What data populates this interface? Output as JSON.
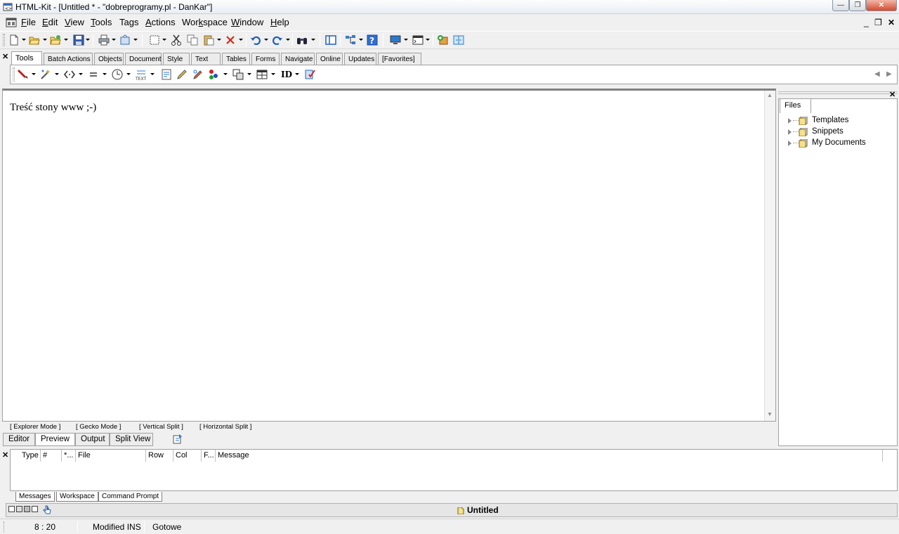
{
  "window": {
    "title": "HTML-Kit - [Untitled * - \"dobreprogramy.pl - DanKar\"]",
    "controls": {
      "minimize": "—",
      "maximize": "❐",
      "close": "✕"
    }
  },
  "menu": {
    "items": [
      {
        "label": "File",
        "accel": "F",
        "rest": "ile"
      },
      {
        "label": "Edit",
        "accel": "E",
        "rest": "dit"
      },
      {
        "label": "View",
        "accel": "V",
        "rest": "iew"
      },
      {
        "label": "Tools",
        "accel": "T",
        "rest": "ools"
      },
      {
        "label": "Tags",
        "pre": "Ta",
        "accel": "g",
        "rest": "s"
      },
      {
        "label": "Actions",
        "accel": "A",
        "rest": "ctions"
      },
      {
        "label": "Workspace",
        "pre": "Wor",
        "accel": "k",
        "rest": "space"
      },
      {
        "label": "Window",
        "accel": "W",
        "rest": "indow"
      },
      {
        "label": "Help",
        "accel": "H",
        "rest": "elp"
      }
    ],
    "mdi": {
      "minimize": "_",
      "restore": "❐",
      "close": "✕"
    }
  },
  "tools_tabs": [
    "Tools",
    "Batch Actions",
    "Objects",
    "Document",
    "Style",
    "Text",
    "Tables",
    "Forms",
    "Navigate",
    "Online",
    "Updates",
    "[Favorites]"
  ],
  "tools_row": {
    "id_label": "ID"
  },
  "editor": {
    "content": "Treść stony www ;-)"
  },
  "files_panel": {
    "tab_label": "Files",
    "tree": [
      "Templates",
      "Snippets",
      "My Documents"
    ]
  },
  "modes": [
    "[ Explorer Mode ]",
    "[ Gecko Mode ]",
    "[ Vertical Split ]",
    "[ Horizontal Split ]"
  ],
  "view_tabs": [
    "Editor",
    "Preview",
    "Output",
    "Split View"
  ],
  "messages": {
    "columns": [
      "Type",
      "#",
      "*...",
      "File",
      "Row",
      "Col",
      "F...",
      "Message"
    ]
  },
  "bottom_tabs": [
    "Messages",
    "Workspace",
    "Command Prompt"
  ],
  "document_bar": {
    "title": "Untitled"
  },
  "status": {
    "position": "8 : 20",
    "mode": "Modified INS",
    "message": "Gotowe"
  },
  "colors": {
    "accent_blue": "#1f5fbf",
    "close_red": "#d34a2e"
  }
}
